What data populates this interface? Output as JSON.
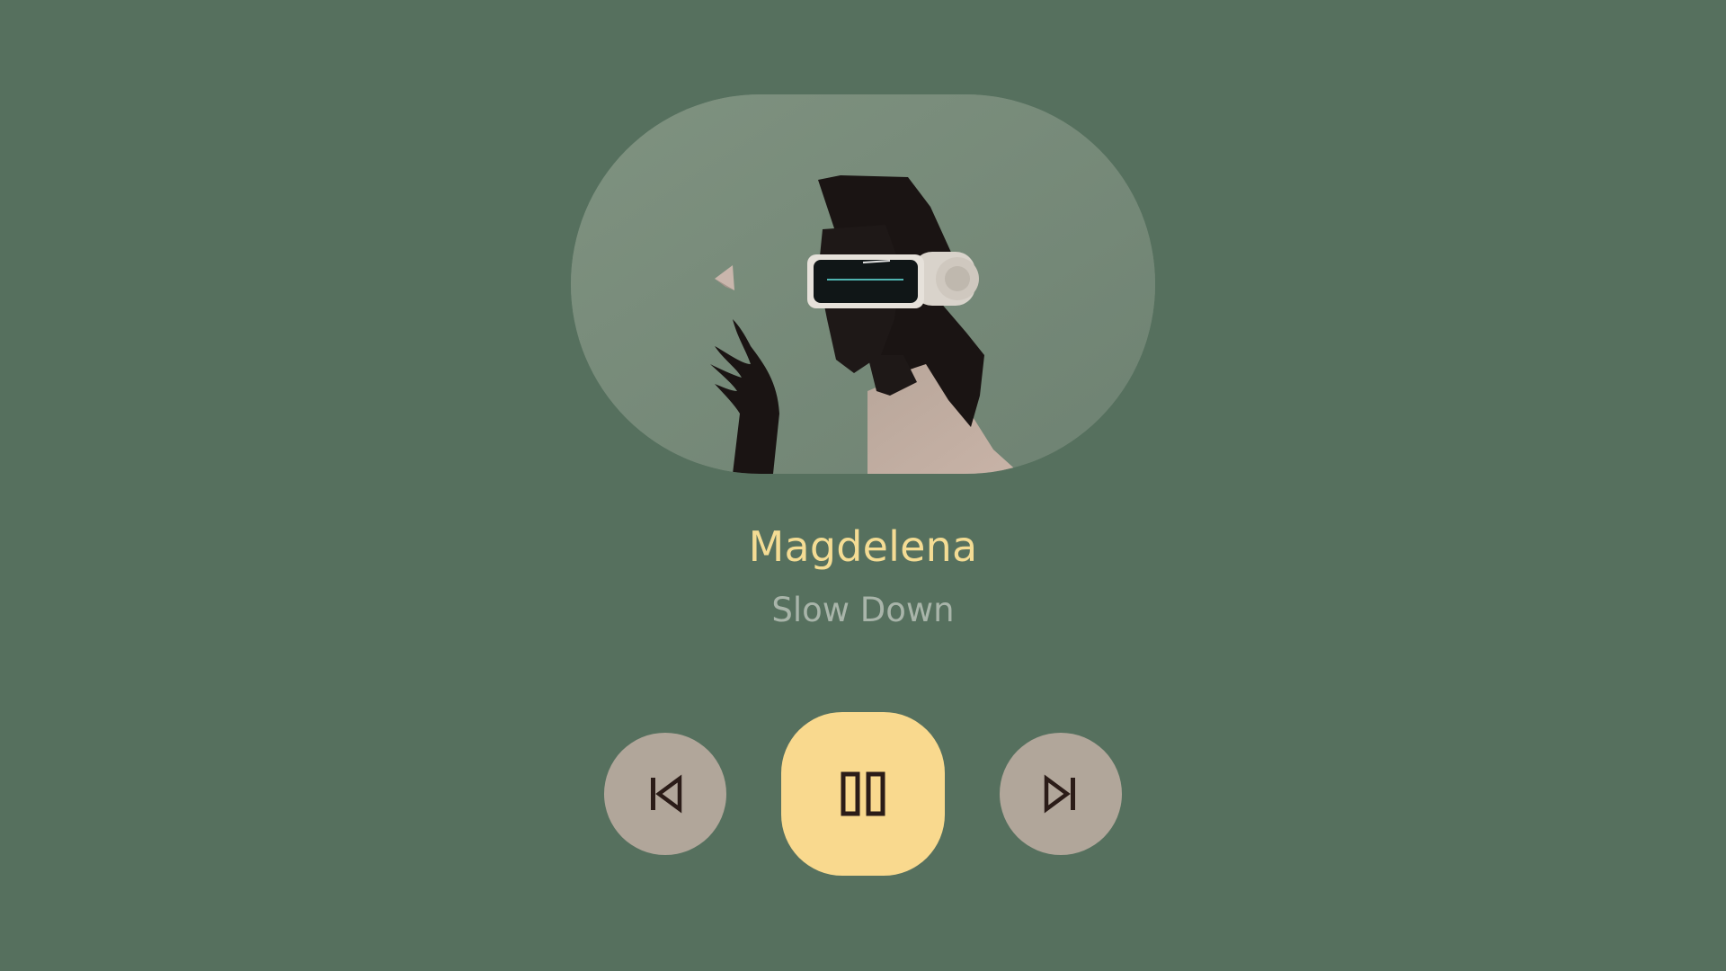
{
  "track": {
    "title": "Magdelena",
    "artist": "Slow Down"
  },
  "controls": {
    "previous_icon": "skip-previous-icon",
    "play_pause_icon": "pause-icon",
    "next_icon": "skip-next-icon",
    "state": "playing"
  },
  "colors": {
    "background": "#56705e",
    "title": "#f4dc94",
    "subtitle": "#a9b5aa",
    "play_button": "#f9d98e",
    "side_buttons": "#b1a69a",
    "icon": "#2b1c18"
  }
}
